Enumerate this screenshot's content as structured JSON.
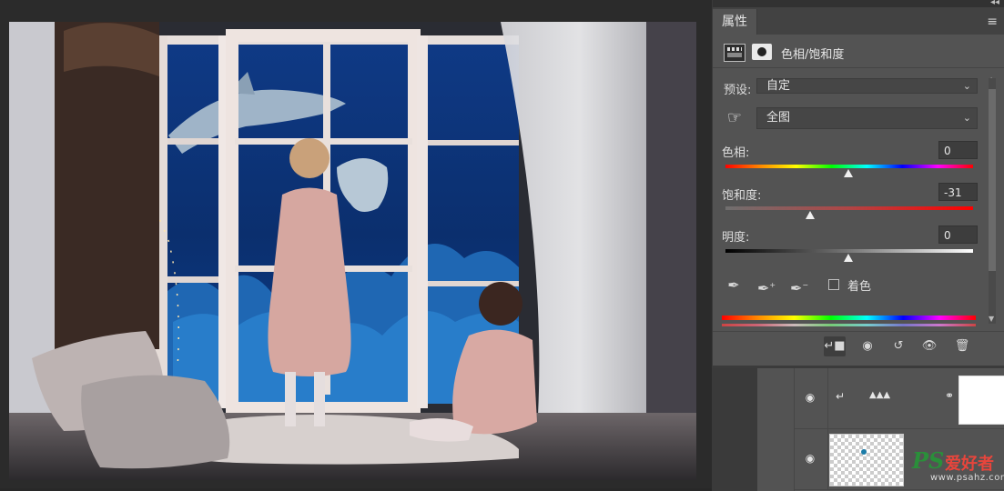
{
  "properties_panel": {
    "tab_label": "属性",
    "collapse_glyph": "◂◂",
    "menu_glyph": "≡",
    "adjustment_title": "色相/饱和度",
    "preset": {
      "label": "预设:",
      "value": "自定"
    },
    "range": {
      "value": "全图"
    },
    "hue": {
      "label": "色相:",
      "value": "0",
      "level": 0
    },
    "saturation": {
      "label": "饱和度:",
      "value": "-31",
      "level": -31
    },
    "lightness": {
      "label": "明度:",
      "value": "0",
      "level": 0
    },
    "colorize": {
      "label": "着色",
      "checked": false
    },
    "footer_buttons": [
      "clip-to-layer",
      "view-previous-state",
      "reset",
      "toggle-visibility",
      "delete"
    ]
  },
  "layers_panel": {
    "rows": [
      {
        "visible": true,
        "type": "hue-saturation-adjustment",
        "clipped": true
      },
      {
        "visible": true,
        "type": "pixel-layer"
      }
    ]
  },
  "watermark": {
    "brand_latin": "PS",
    "brand_cn": "爱好者",
    "url": "www.psahz.com"
  },
  "icons": {
    "hand": "targeted-adjustment-hand-icon",
    "eyedroppers": [
      "eyedropper-icon",
      "eyedropper-plus-icon",
      "eyedropper-minus-icon"
    ]
  }
}
